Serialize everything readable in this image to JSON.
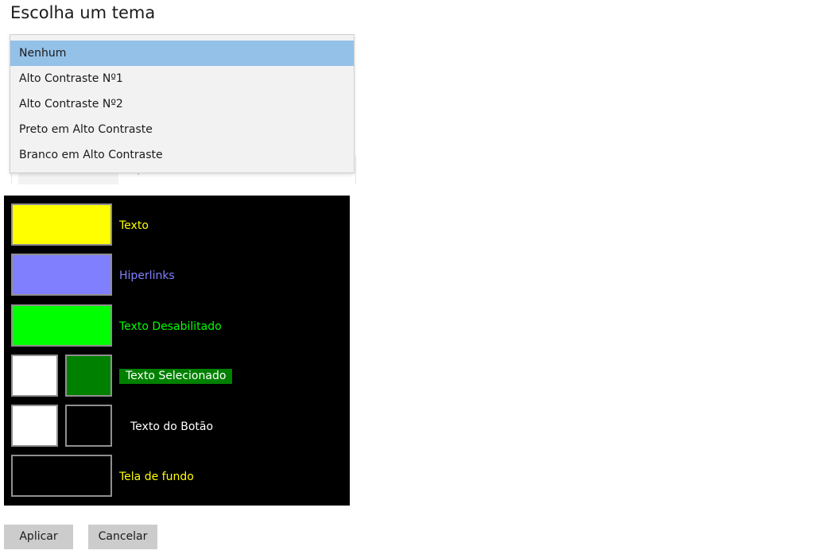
{
  "title": "Escolha um tema",
  "background_preview_text": "Hiperlinks",
  "theme_dropdown": {
    "options": [
      "Nenhum",
      "Alto Contraste Nº1",
      "Alto Contraste Nº2",
      "Preto em Alto Contraste",
      "Branco em Alto Contraste"
    ],
    "selected": "Nenhum",
    "highlight_color": "#94c1e8"
  },
  "preview": {
    "background": "#000000",
    "rows": {
      "text": {
        "label": "Texto",
        "color": "#ffff00",
        "label_color": "#ffff00"
      },
      "hyperlinks": {
        "label": "Hiperlinks",
        "color": "#8080ff",
        "label_color": "#8080ff"
      },
      "disabled_text": {
        "label": "Texto Desabilitado",
        "color": "#00ff00",
        "label_color": "#00ff00"
      },
      "selected_text": {
        "label": "Texto Selecionado",
        "fg_color": "#ffffff",
        "bg_color": "#008000"
      },
      "button_text": {
        "label": "Texto do Botão",
        "fg_color": "#ffffff",
        "bg_color": "#000000"
      },
      "background": {
        "label": "Tela de fundo",
        "color": "#000000",
        "label_color": "#ffff00"
      }
    }
  },
  "buttons": {
    "apply": "Aplicar",
    "cancel": "Cancelar"
  }
}
